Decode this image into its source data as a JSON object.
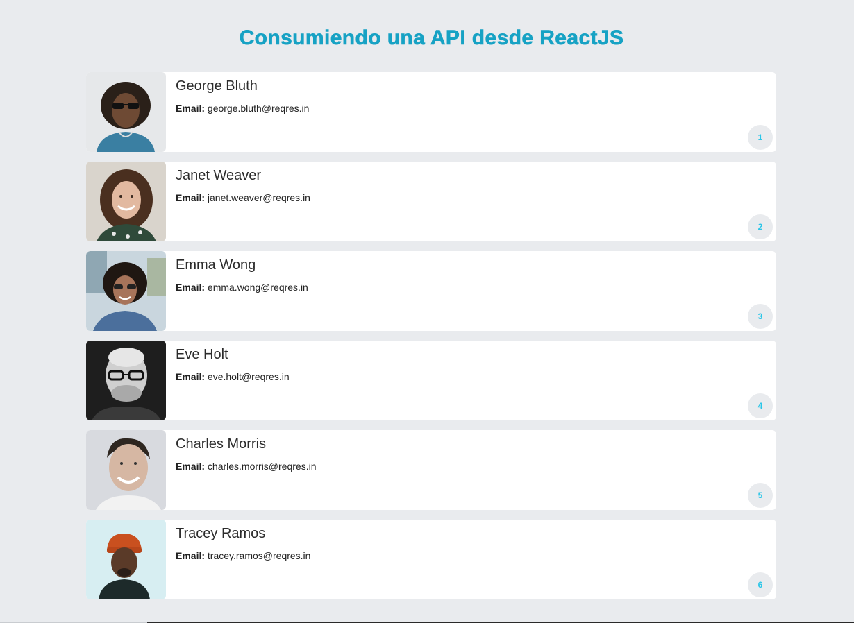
{
  "page": {
    "title": "Consumiendo una API desde ReactJS"
  },
  "colors": {
    "accent": "#17a2c4",
    "badge_text": "#2bc6e8",
    "background": "#e9ebee",
    "card": "#ffffff"
  },
  "users": [
    {
      "id": "1",
      "name": "George Bluth",
      "email_label": "Email:",
      "email": "george.bluth@reqres.in",
      "avatar_icon": "avatar-photo"
    },
    {
      "id": "2",
      "name": "Janet Weaver",
      "email_label": "Email:",
      "email": "janet.weaver@reqres.in",
      "avatar_icon": "avatar-photo"
    },
    {
      "id": "3",
      "name": "Emma Wong",
      "email_label": "Email:",
      "email": "emma.wong@reqres.in",
      "avatar_icon": "avatar-photo"
    },
    {
      "id": "4",
      "name": "Eve Holt",
      "email_label": "Email:",
      "email": "eve.holt@reqres.in",
      "avatar_icon": "avatar-photo"
    },
    {
      "id": "5",
      "name": "Charles Morris",
      "email_label": "Email:",
      "email": "charles.morris@reqres.in",
      "avatar_icon": "avatar-photo"
    },
    {
      "id": "6",
      "name": "Tracey Ramos",
      "email_label": "Email:",
      "email": "tracey.ramos@reqres.in",
      "avatar_icon": "avatar-photo"
    }
  ]
}
